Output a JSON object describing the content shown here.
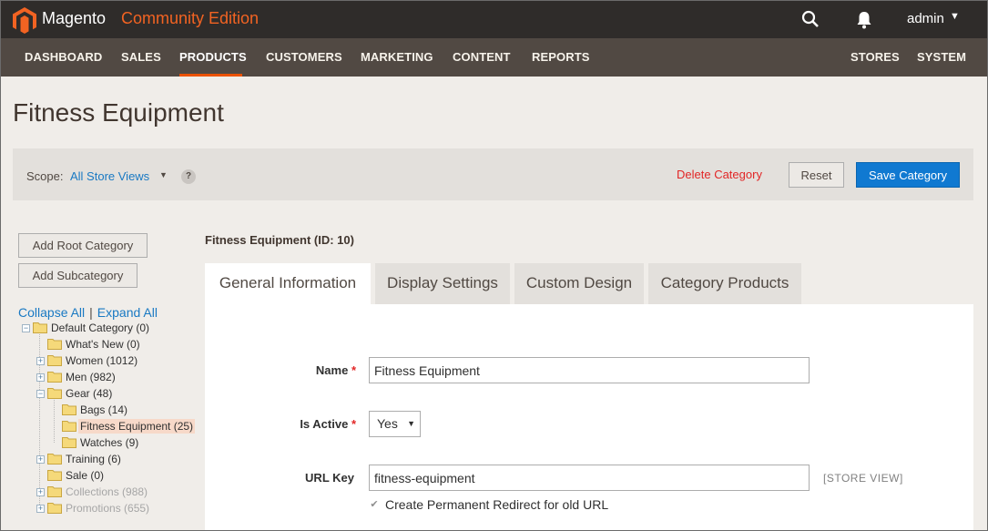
{
  "header": {
    "brand": "Magento",
    "edition": "Community Edition",
    "user": "admin"
  },
  "nav": {
    "items": [
      "DASHBOARD",
      "SALES",
      "PRODUCTS",
      "CUSTOMERS",
      "MARKETING",
      "CONTENT",
      "REPORTS",
      "STORES",
      "SYSTEM"
    ],
    "active": "PRODUCTS"
  },
  "page": {
    "title": "Fitness Equipment"
  },
  "actions": {
    "scope_label": "Scope:",
    "scope_value": "All Store Views",
    "help": "?",
    "delete_label": "Delete Category",
    "reset_label": "Reset",
    "save_label": "Save Category"
  },
  "sidebar": {
    "add_root_label": "Add Root Category",
    "add_sub_label": "Add Subcategory",
    "collapse_label": "Collapse All",
    "separator": "|",
    "expand_label": "Expand All",
    "tree": [
      {
        "label": "Default Category (0)",
        "toggle": "minus"
      },
      {
        "label": "What's New (0)",
        "toggle": "none"
      },
      {
        "label": "Women (1012)",
        "toggle": "plus"
      },
      {
        "label": "Men (982)",
        "toggle": "plus"
      },
      {
        "label": "Gear (48)",
        "toggle": "minus"
      },
      {
        "label": "Bags (14)",
        "toggle": "none"
      },
      {
        "label": "Fitness Equipment (25)",
        "toggle": "none",
        "selected": true
      },
      {
        "label": "Watches (9)",
        "toggle": "none"
      },
      {
        "label": "Training (6)",
        "toggle": "plus"
      },
      {
        "label": "Sale (0)",
        "toggle": "none"
      },
      {
        "label": "Collections (988)",
        "toggle": "plus",
        "disabled": true
      },
      {
        "label": "Promotions (655)",
        "toggle": "plus",
        "disabled": true
      }
    ]
  },
  "content": {
    "category_title": "Fitness Equipment (ID: 10)",
    "tabs": [
      "General Information",
      "Display Settings",
      "Custom Design",
      "Category Products"
    ],
    "active_tab": "General Information",
    "fields": {
      "name_label": "Name",
      "name_value": "Fitness Equipment",
      "active_label": "Is Active",
      "active_value": "Yes",
      "url_label": "URL Key",
      "url_value": "fitness-equipment",
      "scope_note": "[STORE VIEW]",
      "redirect_label": "Create Permanent Redirect for old URL",
      "redirect_checked": true
    },
    "required_marker": "*"
  },
  "colors": {
    "accent": "#eb5202",
    "save_button": "#1079d1",
    "delete_link": "#e22626",
    "topbar": "#2f2c2a",
    "nav": "#514943"
  }
}
